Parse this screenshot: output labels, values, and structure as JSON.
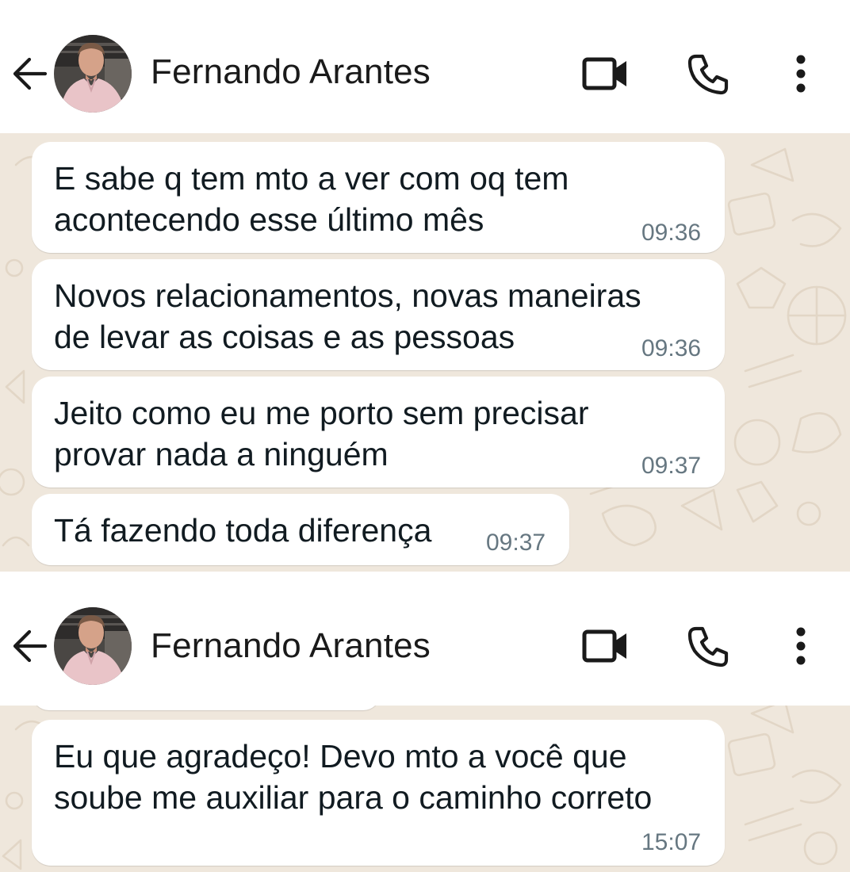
{
  "contact": {
    "name": "Fernando Arantes"
  },
  "icons": {
    "back": "arrow-left-icon",
    "video": "video-camera-icon",
    "call": "phone-icon",
    "menu": "more-vertical-icon"
  },
  "colors": {
    "chat_background": "#efe7dc",
    "bubble_incoming": "#ffffff",
    "timestamp": "#667781",
    "text": "#111b21"
  },
  "screen1": {
    "messages": [
      {
        "text_line1": "E sabe q tem mto a ver com oq tem",
        "text_line2": "acontecendo esse último mês",
        "time": "09:36"
      },
      {
        "text_line1": "Novos relacionamentos, novas maneiras",
        "text_line2": "de levar as coisas e as pessoas",
        "time": "09:36"
      },
      {
        "text_line1": "Jeito como eu me porto sem precisar",
        "text_line2": "provar nada a ninguém",
        "time": "09:37"
      },
      {
        "text_line1": "Tá fazendo toda diferença",
        "time": "09:37"
      }
    ]
  },
  "screen2": {
    "messages": [
      {
        "text_line1": "Eu que agradeço! Devo mto a você que",
        "text_line2": "soube me auxiliar para o caminho correto",
        "time": "15:07"
      }
    ]
  }
}
